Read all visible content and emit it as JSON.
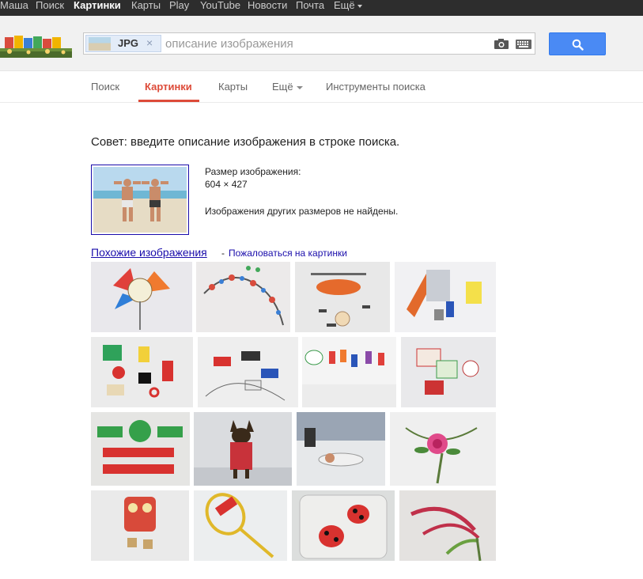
{
  "topbar": {
    "items": [
      "Маша",
      "Поиск",
      "Картинки",
      "Карты",
      "Play",
      "YouTube",
      "Новости",
      "Почта",
      "Ещё"
    ],
    "active_index": 2
  },
  "search": {
    "chip_label": "JPG",
    "chip_close": "×",
    "placeholder": "описание изображения",
    "value": ""
  },
  "nav": {
    "tabs": [
      "Поиск",
      "Картинки",
      "Карты",
      "Ещё",
      "Инструменты поиска"
    ],
    "active_index": 1
  },
  "tip": "Совет: введите описание изображения в строке поиска.",
  "image_info": {
    "size_label": "Размер изображения:",
    "size_value": "604 × 427",
    "other_sizes": "Изображения других размеров не найдены."
  },
  "similar": {
    "link": "Похожие изображения",
    "separator": "-",
    "report": "Пожаловаться на картинки"
  },
  "results_rows": [
    [
      "fan-brooch-pin",
      "beaded-bracelet",
      "toy-helicopter-kit",
      "robot-figure-parts"
    ],
    [
      "plastic-toy-parts",
      "toy-cars-strings",
      "ice-cream-magnets",
      "gift-tags"
    ],
    [
      "chinese-sign",
      "dog-in-sweater",
      "martial-arts-class",
      "pink-flower-arrangement"
    ],
    [
      "fabric-owl-keychain",
      "squash-racket",
      "ladybug-plate",
      "red-plant-sprouts"
    ]
  ],
  "colors": {
    "topbar_bg": "#2d2d2d",
    "header_bg": "#f1f1f1",
    "accent_red": "#dd4b39",
    "search_button": "#4a8af4",
    "link_blue": "#1a0dab"
  }
}
